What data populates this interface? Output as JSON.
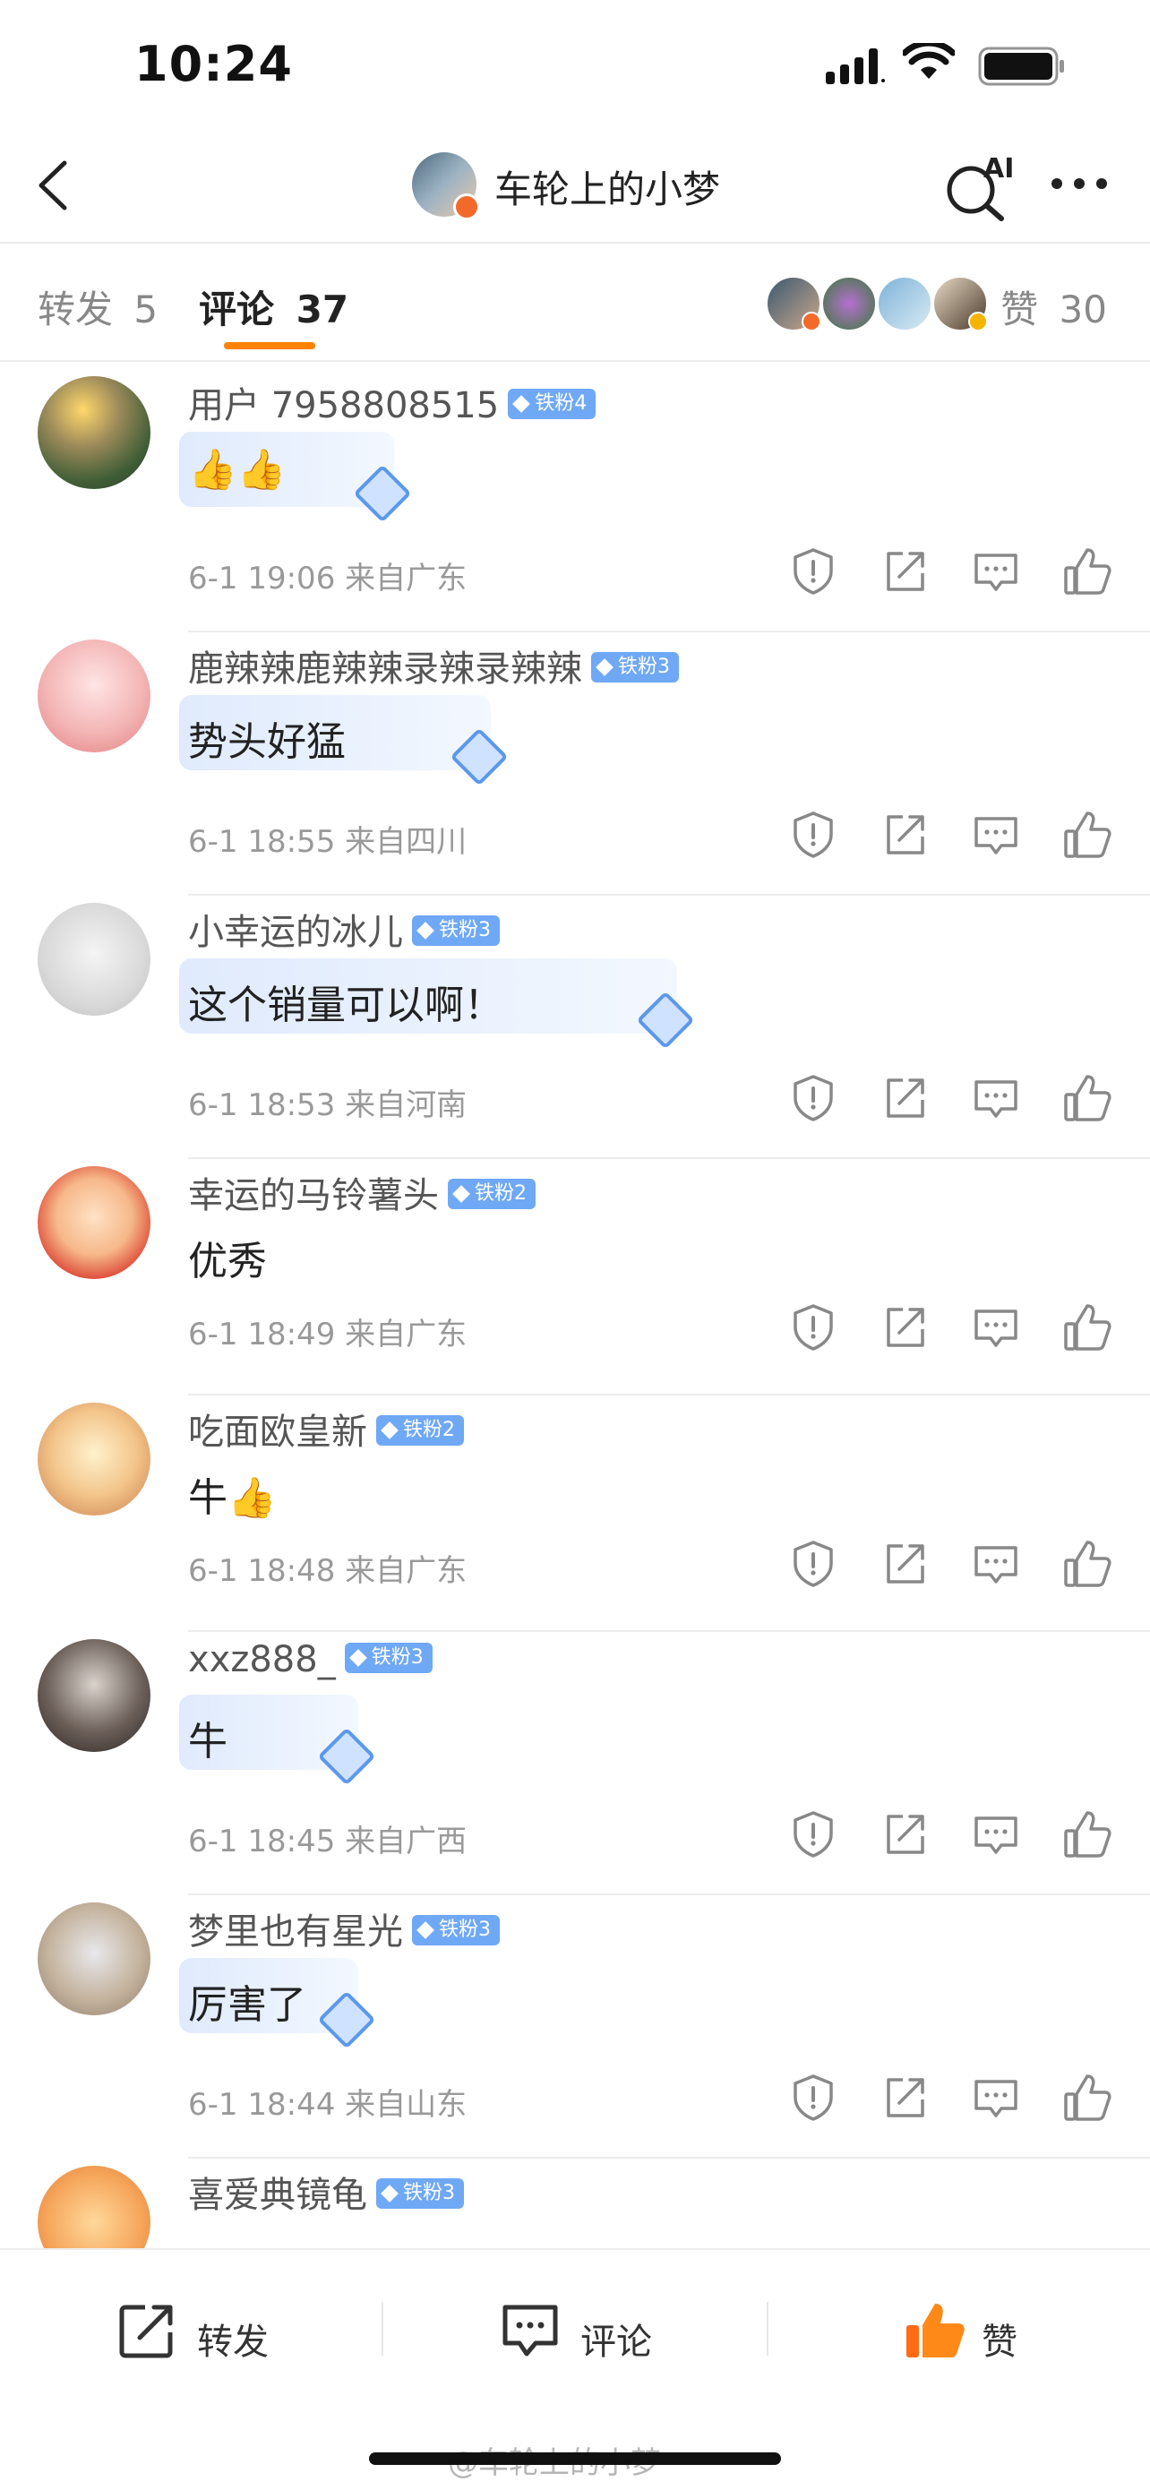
{
  "status_bar": {
    "time": "10:24"
  },
  "nav": {
    "title": "车轮上的小梦",
    "ai_label": "AI"
  },
  "tabs": [
    {
      "label": "转发",
      "count": "5"
    },
    {
      "label": "评论",
      "count": "37"
    }
  ],
  "likes": {
    "label": "赞",
    "count": "30"
  },
  "comments": [
    {
      "user": "用户 7958808515",
      "badge": "铁粉4",
      "text": "👍👍",
      "meta": "6-1 19:06  来自广东",
      "has_bubble": true
    },
    {
      "user": "鹿辣辣鹿辣辣录辣录辣辣",
      "badge": "铁粉3",
      "text": "势头好猛",
      "meta": "6-1 18:55  来自四川",
      "has_bubble": true
    },
    {
      "user": "小幸运的冰儿",
      "badge": "铁粉3",
      "text": "这个销量可以啊！",
      "meta": "6-1 18:53  来自河南",
      "has_bubble": true
    },
    {
      "user": "幸运的马铃薯头",
      "badge": "铁粉2",
      "text": "优秀",
      "meta": "6-1 18:49  来自广东",
      "has_bubble": false
    },
    {
      "user": "吃面欧皇新",
      "badge": "铁粉2",
      "text": "牛👍",
      "meta": "6-1 18:48  来自广东",
      "has_bubble": false
    },
    {
      "user": "xxz888_",
      "badge": "铁粉3",
      "text": "牛",
      "meta": "6-1 18:45  来自广西",
      "has_bubble": true
    },
    {
      "user": "梦里也有星光",
      "badge": "铁粉3",
      "text": "厉害了",
      "meta": "6-1 18:44  来自山东",
      "has_bubble": true
    },
    {
      "user": "喜爱典镜龟",
      "badge": "铁粉3",
      "text": "",
      "meta": "",
      "has_bubble": false
    }
  ],
  "bottom_bar": {
    "repost": "转发",
    "comment": "评论",
    "like": "赞"
  },
  "watermark": "@车轮上的小梦",
  "colors": {
    "accent": "#ff8200",
    "badge": "#6fa8f5",
    "like": "#ff6a13"
  }
}
